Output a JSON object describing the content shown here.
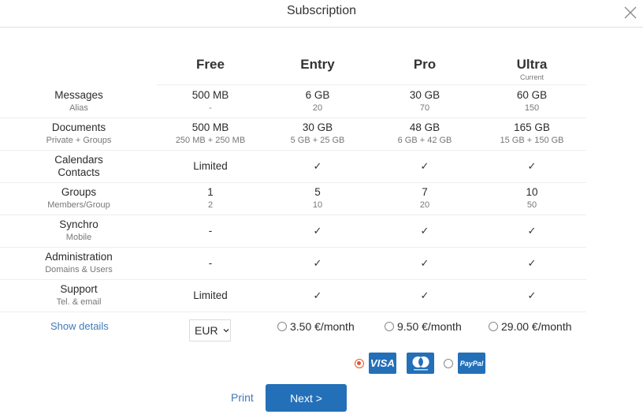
{
  "dialog": {
    "title": "Subscription",
    "close_icon": "close-icon"
  },
  "plans": [
    {
      "name": "Free",
      "note": ""
    },
    {
      "name": "Entry",
      "note": ""
    },
    {
      "name": "Pro",
      "note": ""
    },
    {
      "name": "Ultra",
      "note": "Current"
    }
  ],
  "features": [
    {
      "label": "Messages",
      "sublabel": "Alias",
      "values": [
        {
          "main": "500 MB",
          "sub": "-"
        },
        {
          "main": "6 GB",
          "sub": "20"
        },
        {
          "main": "30 GB",
          "sub": "70"
        },
        {
          "main": "60 GB",
          "sub": "150"
        }
      ]
    },
    {
      "label": "Documents",
      "sublabel": "Private + Groups",
      "values": [
        {
          "main": "500 MB",
          "sub": "250 MB + 250 MB"
        },
        {
          "main": "30 GB",
          "sub": "5 GB + 25 GB"
        },
        {
          "main": "48 GB",
          "sub": "6 GB + 42 GB"
        },
        {
          "main": "165 GB",
          "sub": "15 GB + 150 GB"
        }
      ]
    },
    {
      "label": "Calendars",
      "sublabel": "Contacts",
      "values": [
        {
          "main": "Limited",
          "sub": ""
        },
        {
          "main": "✓",
          "sub": ""
        },
        {
          "main": "✓",
          "sub": ""
        },
        {
          "main": "✓",
          "sub": ""
        }
      ]
    },
    {
      "label": "Groups",
      "sublabel": "Members/Group",
      "values": [
        {
          "main": "1",
          "sub": "2"
        },
        {
          "main": "5",
          "sub": "10"
        },
        {
          "main": "7",
          "sub": "20"
        },
        {
          "main": "10",
          "sub": "50"
        }
      ]
    },
    {
      "label": "Synchro",
      "sublabel": "Mobile",
      "values": [
        {
          "main": "-",
          "sub": ""
        },
        {
          "main": "✓",
          "sub": ""
        },
        {
          "main": "✓",
          "sub": ""
        },
        {
          "main": "✓",
          "sub": ""
        }
      ]
    },
    {
      "label": "Administration",
      "sublabel": "Domains & Users",
      "values": [
        {
          "main": "-",
          "sub": ""
        },
        {
          "main": "✓",
          "sub": ""
        },
        {
          "main": "✓",
          "sub": ""
        },
        {
          "main": "✓",
          "sub": ""
        }
      ]
    },
    {
      "label": "Support",
      "sublabel": "Tel. & email",
      "values": [
        {
          "main": "Limited",
          "sub": ""
        },
        {
          "main": "✓",
          "sub": ""
        },
        {
          "main": "✓",
          "sub": ""
        },
        {
          "main": "✓",
          "sub": ""
        }
      ]
    }
  ],
  "footer": {
    "show_details_label": "Show details",
    "currency": {
      "selected": "EUR"
    },
    "prices": [
      {
        "plan": "Entry",
        "label": "3.50 €/month",
        "selected": false
      },
      {
        "plan": "Pro",
        "label": "9.50 €/month",
        "selected": false
      },
      {
        "plan": "Ultra",
        "label": "29.00 €/month",
        "selected": false
      }
    ],
    "payment_methods": [
      {
        "name": "Visa + Mastercard",
        "visa_label": "VISA",
        "mastercard_label": "mastercard",
        "selected": true
      },
      {
        "name": "PayPal",
        "label": "PayPal",
        "selected": false
      }
    ],
    "print_label": "Print",
    "next_label": "Next >"
  },
  "colors": {
    "accent": "#2370b9",
    "link": "#3d7ab8",
    "radio_selected": "#e8542c"
  }
}
